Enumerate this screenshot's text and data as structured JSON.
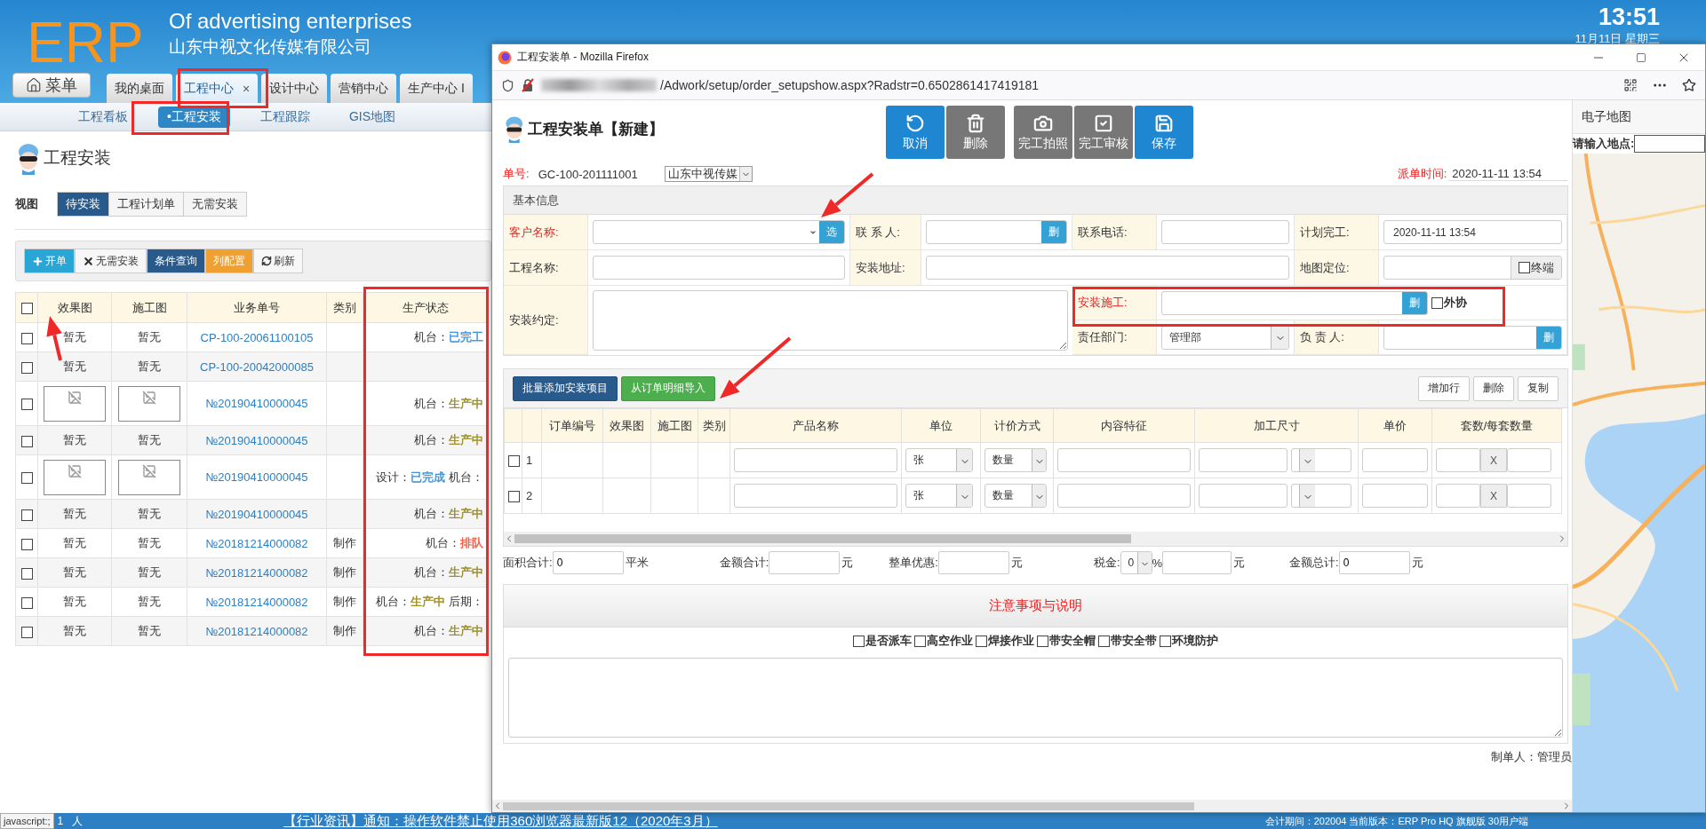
{
  "header": {
    "logo": "ERP",
    "tagline": "Of advertising enterprises",
    "company": "山东中视文化传媒有限公司",
    "clock": {
      "time": "13:51",
      "date": "11月11日 星期三"
    }
  },
  "menu_button": "菜单",
  "tabs": [
    {
      "label": "我的桌面",
      "selected": false
    },
    {
      "label": "工程中心",
      "selected": true,
      "close": "×"
    },
    {
      "label": "设计中心",
      "selected": false
    },
    {
      "label": "营销中心",
      "selected": false
    },
    {
      "label": "生产中心 I",
      "selected": false
    }
  ],
  "subnav": [
    {
      "label": "工程看板",
      "selected": false
    },
    {
      "label": "•工程安装",
      "selected": true
    },
    {
      "label": "工程跟踪",
      "selected": false
    },
    {
      "label": "GIS地图",
      "selected": false
    }
  ],
  "page_title": "工程安装",
  "view": {
    "label": "视图",
    "options": [
      {
        "label": "待安装",
        "selected": true
      },
      {
        "label": "工程计划单",
        "selected": false
      },
      {
        "label": "无需安装",
        "selected": false
      }
    ]
  },
  "toolbar": [
    {
      "label": "开单",
      "kind": "create"
    },
    {
      "label": "无需安装",
      "kind": "dismiss"
    },
    {
      "label": "条件查询",
      "kind": "query"
    },
    {
      "label": "列配置",
      "kind": "columns"
    },
    {
      "label": "刷新",
      "kind": "refresh"
    }
  ],
  "table": {
    "select_all_checked": false,
    "columns": [
      "效果图",
      "施工图",
      "业务单号",
      "类别",
      "生产状态"
    ],
    "rows": [
      {
        "kind": "text",
        "checked": false,
        "effect": "暂无",
        "drawing": "暂无",
        "order_no": "CP-100-20061100105",
        "status": [
          {
            "label": "机台：",
            "value": "已完工",
            "color": "#3b8fd6"
          }
        ]
      },
      {
        "kind": "text",
        "checked": false,
        "effect": "暂无",
        "drawing": "暂无",
        "order_no": "CP-100-20042000085",
        "status": []
      },
      {
        "kind": "image",
        "checked": false,
        "order_no": "№20190410000045",
        "status": [
          {
            "label": "机台：",
            "value": "生产中",
            "color": "#9a8a20"
          }
        ]
      },
      {
        "kind": "text",
        "checked": false,
        "effect": "暂无",
        "drawing": "暂无",
        "order_no": "№20190410000045",
        "status": [
          {
            "label": "机台：",
            "value": "生产中",
            "color": "#9a8a20"
          }
        ]
      },
      {
        "kind": "image",
        "checked": false,
        "order_no": "№20190410000045",
        "status": [
          {
            "label": "设计：",
            "value": "已完成",
            "color": "#3b8fd6"
          },
          {
            "label": "机台："
          }
        ]
      },
      {
        "kind": "text",
        "checked": false,
        "effect": "暂无",
        "drawing": "暂无",
        "order_no": "№20190410000045",
        "status": [
          {
            "label": "机台：",
            "value": "生产中",
            "color": "#9a8a20"
          }
        ]
      },
      {
        "kind": "text",
        "checked": false,
        "effect": "暂无",
        "drawing": "暂无",
        "order_no": "№20181214000082",
        "category": "制作",
        "status": [
          {
            "label": "机台：",
            "value": "排队",
            "color": "#f0553f"
          }
        ]
      },
      {
        "kind": "text",
        "checked": false,
        "effect": "暂无",
        "drawing": "暂无",
        "order_no": "№20181214000082",
        "category": "制作",
        "status": [
          {
            "label": "机台：",
            "value": "生产中",
            "color": "#9a8a20"
          }
        ]
      },
      {
        "kind": "text",
        "checked": false,
        "effect": "暂无",
        "drawing": "暂无",
        "order_no": "№20181214000082",
        "category": "制作",
        "status": [
          {
            "label": "机台：",
            "value": "生产中",
            "color": "#9a8a20"
          },
          {
            "label": "后期："
          }
        ]
      },
      {
        "kind": "text",
        "checked": false,
        "effect": "暂无",
        "drawing": "暂无",
        "order_no": "№20181214000082",
        "category": "制作",
        "status": [
          {
            "label": "机台：",
            "value": "生产中",
            "color": "#9a8a20"
          }
        ]
      }
    ]
  },
  "popup": {
    "title": "工程安装单 - Mozilla Firefox",
    "url": "/Adwork/setup/order_setupshow.aspx?Radstr=0.6502861417419181",
    "form": {
      "title": "工程安装单【新建】",
      "actions": [
        {
          "label": "取消",
          "kind": "cancel"
        },
        {
          "label": "删除",
          "kind": "delete"
        },
        {
          "label": "完工拍照",
          "kind": "photo"
        },
        {
          "label": "完工审核",
          "kind": "audit"
        },
        {
          "label": "保存",
          "kind": "save"
        }
      ],
      "order_no": {
        "label": "单号:",
        "value": "GC-100-201111001"
      },
      "company_select": "山东中视传媒",
      "dispatch_time": {
        "label": "派单时间:",
        "value": "2020-11-11 13:54"
      },
      "basic_info": {
        "title": "基本信息",
        "customer": {
          "label": "客户名称:",
          "required": true,
          "button": "选"
        },
        "contact": {
          "label": "联 系 人:",
          "required": false,
          "button": "删"
        },
        "phone": {
          "label": "联系电话:",
          "required": false
        },
        "planned": {
          "label": "计划完工:",
          "required": false,
          "value": "2020-11-11 13:54"
        },
        "project": {
          "label": "工程名称:",
          "required": false
        },
        "address": {
          "label": "安装地址:",
          "required": false
        },
        "location": {
          "label": "地图定位:",
          "required": false,
          "checkbox": {
            "label": "终端",
            "checked": false
          }
        },
        "agreement": {
          "label": "安装约定:",
          "required": false
        },
        "installer": {
          "label": "安装施工:",
          "required": true,
          "button": "删",
          "checkbox": {
            "label": "外协",
            "checked": false
          }
        },
        "department": {
          "label": "责任部门:",
          "required": false,
          "value": "管理部"
        },
        "manager": {
          "label": "负 责 人:",
          "required": false,
          "button": "删"
        }
      },
      "items": {
        "left_buttons": [
          {
            "label": "批量添加安装项目",
            "kind": "batch"
          },
          {
            "label": "从订单明细导入",
            "kind": "import"
          }
        ],
        "right_buttons": [
          "增加行",
          "删除",
          "复制"
        ],
        "columns": [
          "订单编号",
          "效果图",
          "施工图",
          "类别",
          "产品名称",
          "单位",
          "计价方式",
          "内容特征",
          "加工尺寸",
          "单价",
          "套数/每套数量"
        ],
        "rows": [
          {
            "no": "1",
            "checked": false,
            "unit": "张",
            "pricing": "数量",
            "multiply": "X"
          },
          {
            "no": "2",
            "checked": false,
            "unit": "张",
            "pricing": "数量",
            "multiply": "X"
          }
        ]
      },
      "totals": [
        {
          "kind": "field",
          "label": "面积合计:",
          "value": "0",
          "unit": "平米"
        },
        {
          "kind": "field",
          "label": "金额合计:",
          "unit": "元"
        },
        {
          "kind": "field",
          "label": "整单优惠:",
          "unit": "元"
        },
        {
          "kind": "tax",
          "label": "税金:",
          "select": "0",
          "percent": "%",
          "unit": "元"
        },
        {
          "kind": "field",
          "label": "金额总计:",
          "value": "0",
          "unit": "元"
        }
      ],
      "notes": {
        "title": "注意事项与说明",
        "options": [
          {
            "label": "是否派车",
            "checked": false
          },
          {
            "label": "高空作业",
            "checked": false
          },
          {
            "label": "焊接作业",
            "checked": false
          },
          {
            "label": "带安全帽",
            "checked": false
          },
          {
            "label": "带安全带",
            "checked": false
          },
          {
            "label": "环境防护",
            "checked": false
          }
        ]
      },
      "creator": "制单人：管理员"
    },
    "map": {
      "title": "电子地图",
      "search_label": "请输入地点:"
    }
  },
  "status_bar": {
    "link": "javascript:;",
    "online_count": "1",
    "online_unit": "人",
    "news": "【行业资讯】通知：操作软件禁止使用360浏览器最新版12（2020年3月）",
    "info": "会计期间：202004 当前版本：ERP Pro HQ 旗舰版 30用户端"
  }
}
